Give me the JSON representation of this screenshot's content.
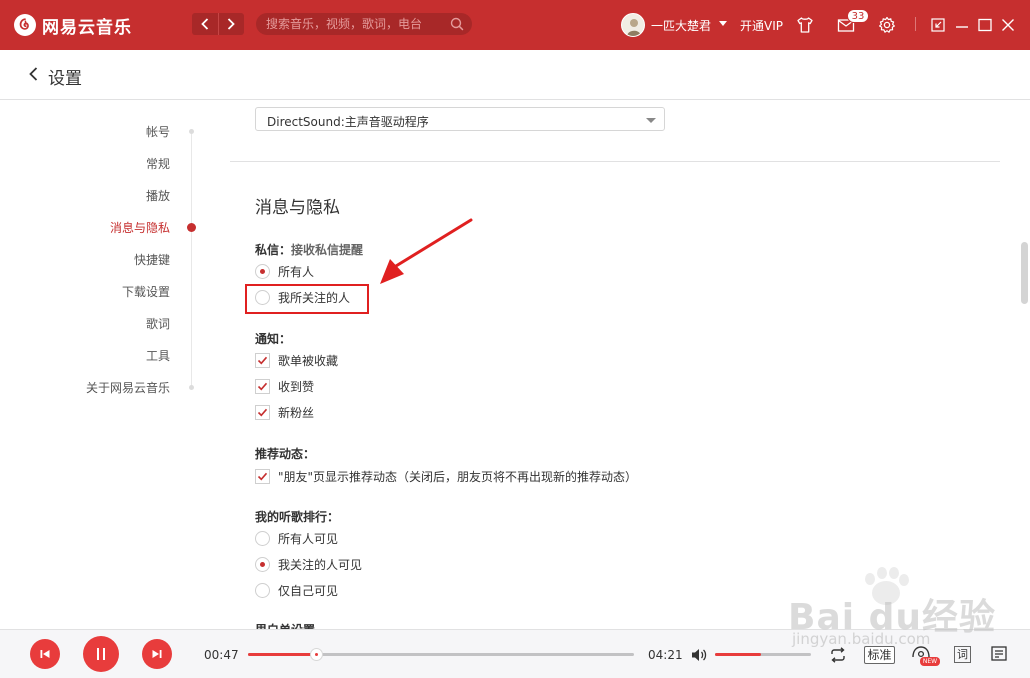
{
  "app": {
    "name": "网易云音乐",
    "search_placeholder": "搜索音乐，视频，歌词，电台",
    "username": "一匹大楚君",
    "vip_label": "开通VIP",
    "mail_badge": "33"
  },
  "header": {
    "title": "设置"
  },
  "sidebar": {
    "items": [
      {
        "label": "帐号",
        "active": false
      },
      {
        "label": "常规",
        "active": false
      },
      {
        "label": "播放",
        "active": false
      },
      {
        "label": "消息与隐私",
        "active": true
      },
      {
        "label": "快捷键",
        "active": false
      },
      {
        "label": "下载设置",
        "active": false
      },
      {
        "label": "歌词",
        "active": false
      },
      {
        "label": "工具",
        "active": false
      },
      {
        "label": "关于网易云音乐",
        "active": false
      }
    ]
  },
  "main": {
    "output_device": "DirectSound:主声音驱动程序",
    "section_title": "消息与隐私",
    "private_message": {
      "label": "私信：",
      "hint": "接收私信提醒",
      "options": [
        {
          "label": "所有人",
          "selected": true
        },
        {
          "label": "我所关注的人",
          "selected": false
        }
      ]
    },
    "notifications": {
      "label": "通知：",
      "options": [
        {
          "label": "歌单被收藏",
          "checked": true
        },
        {
          "label": "收到赞",
          "checked": true
        },
        {
          "label": "新粉丝",
          "checked": true
        }
      ]
    },
    "recommend": {
      "label": "推荐动态：",
      "options": [
        {
          "label": "\"朋友\"页显示推荐动态（关闭后，朋友页将不再出现新的推荐动态）",
          "checked": true
        }
      ]
    },
    "ranking": {
      "label": "我的听歌排行：",
      "options": [
        {
          "label": "所有人可见",
          "selected": false
        },
        {
          "label": "我关注的人可见",
          "selected": true
        },
        {
          "label": "仅自己可见",
          "selected": false
        }
      ]
    },
    "next_section_label": "里白单设置"
  },
  "player": {
    "current_time": "00:47",
    "total_time": "04:21",
    "progress": 0.18,
    "volume": 0.48,
    "quality_label": "标准",
    "lyric_label": "词",
    "new_badge": "NEW"
  },
  "watermark": {
    "text": "Bai du经验",
    "sub": "jingyan.baidu.com"
  },
  "colors": {
    "brand": "#c62f2f",
    "accent": "#e83c3c",
    "annotation": "#e02020"
  },
  "icons": {
    "logo": "netease-logo-icon",
    "back": "chevron-left-icon",
    "search": "search-icon",
    "skin": "tshirt-icon",
    "mail": "mail-icon",
    "settings": "gear-icon",
    "mini": "mini-mode-icon",
    "minimize": "minimize-icon",
    "maximize": "maximize-icon",
    "close": "close-icon"
  }
}
